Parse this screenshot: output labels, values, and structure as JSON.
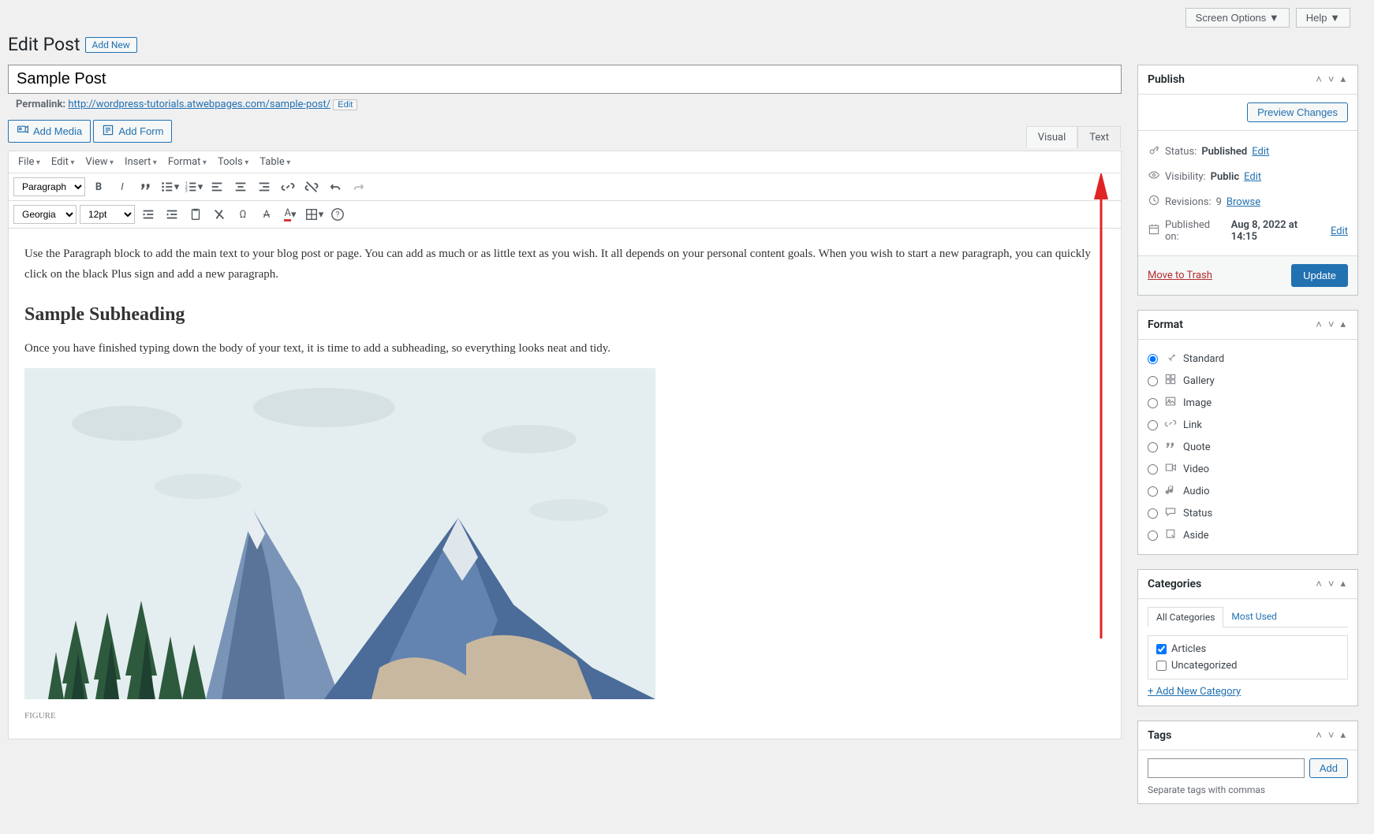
{
  "header": {
    "screen_options": "Screen Options",
    "help": "Help"
  },
  "page": {
    "title": "Edit Post",
    "add_new": "Add New"
  },
  "post": {
    "title_value": "Sample Post",
    "permalink_label": "Permalink:",
    "permalink_url": "http://wordpress-tutorials.atwebpages.com/sample-post/",
    "edit": "Edit"
  },
  "media": {
    "add_media": "Add Media",
    "add_form": "Add Form"
  },
  "tabs": {
    "visual": "Visual",
    "text": "Text"
  },
  "menus": [
    "File",
    "Edit",
    "View",
    "Insert",
    "Format",
    "Tools",
    "Table"
  ],
  "toolbar1": {
    "paragraph": "Paragraph"
  },
  "toolbar2": {
    "font": "Georgia",
    "size": "12pt"
  },
  "content": {
    "p1": "Use the Paragraph block to add the main text to your blog post or page. You can add as much or as little text as you wish. It all depends on your personal content goals. When you wish to start a new paragraph, you can quickly click on the black Plus sign and add a new paragraph.",
    "h2": "Sample Subheading",
    "p2": "Once you have finished typing down the body of your text, it is time to add a subheading, so everything looks neat and tidy.",
    "figure_label": "FIGURE"
  },
  "publish": {
    "title": "Publish",
    "preview": "Preview Changes",
    "status_label": "Status:",
    "status_value": "Published",
    "visibility_label": "Visibility:",
    "visibility_value": "Public",
    "revisions_label": "Revisions:",
    "revisions_count": "9",
    "browse": "Browse",
    "published_label": "Published on:",
    "published_value": "Aug 8, 2022 at 14:15",
    "edit": "Edit",
    "trash": "Move to Trash",
    "update": "Update"
  },
  "format": {
    "title": "Format",
    "items": [
      "Standard",
      "Gallery",
      "Image",
      "Link",
      "Quote",
      "Video",
      "Audio",
      "Status",
      "Aside"
    ]
  },
  "categories": {
    "title": "Categories",
    "tab_all": "All Categories",
    "tab_most": "Most Used",
    "items": [
      "Articles",
      "Uncategorized"
    ],
    "add_new": "+ Add New Category"
  },
  "tags": {
    "title": "Tags",
    "add": "Add",
    "help": "Separate tags with commas"
  }
}
